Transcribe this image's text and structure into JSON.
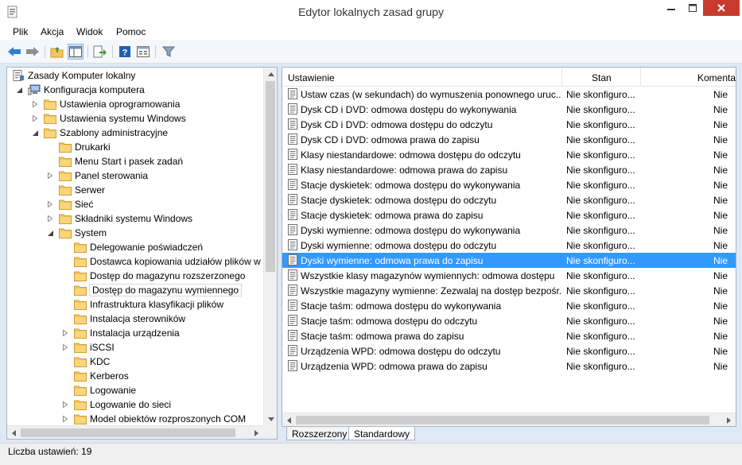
{
  "window": {
    "title": "Edytor lokalnych zasad grupy"
  },
  "menu": [
    "Plik",
    "Akcja",
    "Widok",
    "Pomoc"
  ],
  "toolbar": [
    "back-icon",
    "forward-icon",
    "up-folder-icon",
    "show-hide-tree-icon",
    "export-list-icon",
    "help-icon",
    "properties-icon",
    "filter-icon"
  ],
  "tree": {
    "root": "Zasady Komputer lokalny",
    "items": [
      {
        "label": "Konfiguracja komputera",
        "level": 1,
        "expander": "expanded",
        "icon": "computer-icon"
      },
      {
        "label": "Ustawienia oprogramowania",
        "level": 2,
        "expander": "collapsed",
        "icon": "folder-icon"
      },
      {
        "label": "Ustawienia systemu Windows",
        "level": 2,
        "expander": "collapsed",
        "icon": "folder-icon"
      },
      {
        "label": "Szablony administracyjne",
        "level": 2,
        "expander": "expanded",
        "icon": "folder-icon"
      },
      {
        "label": "Drukarki",
        "level": 3,
        "expander": "none",
        "icon": "folder-icon"
      },
      {
        "label": "Menu Start i pasek zadań",
        "level": 3,
        "expander": "none",
        "icon": "folder-icon"
      },
      {
        "label": "Panel sterowania",
        "level": 3,
        "expander": "collapsed",
        "icon": "folder-icon"
      },
      {
        "label": "Serwer",
        "level": 3,
        "expander": "none",
        "icon": "folder-icon"
      },
      {
        "label": "Sieć",
        "level": 3,
        "expander": "collapsed",
        "icon": "folder-icon"
      },
      {
        "label": "Składniki systemu Windows",
        "level": 3,
        "expander": "collapsed",
        "icon": "folder-icon"
      },
      {
        "label": "System",
        "level": 3,
        "expander": "expanded",
        "icon": "folder-icon"
      },
      {
        "label": "Delegowanie poświadczeń",
        "level": 4,
        "expander": "none",
        "icon": "folder-icon"
      },
      {
        "label": "Dostawca kopiowania udziałów plików w t",
        "level": 4,
        "expander": "none",
        "icon": "folder-icon"
      },
      {
        "label": "Dostęp do magazynu rozszerzonego",
        "level": 4,
        "expander": "none",
        "icon": "folder-icon"
      },
      {
        "label": "Dostęp do magazynu wymiennego",
        "level": 4,
        "expander": "none",
        "icon": "folder-icon",
        "selected": true
      },
      {
        "label": "Infrastruktura klasyfikacji plików",
        "level": 4,
        "expander": "none",
        "icon": "folder-icon"
      },
      {
        "label": "Instalacja sterowników",
        "level": 4,
        "expander": "none",
        "icon": "folder-icon"
      },
      {
        "label": "Instalacja urządzenia",
        "level": 4,
        "expander": "collapsed",
        "icon": "folder-icon"
      },
      {
        "label": "iSCSI",
        "level": 4,
        "expander": "collapsed",
        "icon": "folder-icon"
      },
      {
        "label": "KDC",
        "level": 4,
        "expander": "none",
        "icon": "folder-icon"
      },
      {
        "label": "Kerberos",
        "level": 4,
        "expander": "none",
        "icon": "folder-icon"
      },
      {
        "label": "Logowanie",
        "level": 4,
        "expander": "none",
        "icon": "folder-icon"
      },
      {
        "label": "Logowanie do sieci",
        "level": 4,
        "expander": "collapsed",
        "icon": "folder-icon"
      },
      {
        "label": "Model obiektów rozproszonych COM",
        "level": 4,
        "expander": "collapsed",
        "icon": "folder-icon"
      }
    ]
  },
  "list": {
    "columns": [
      "Ustawienie",
      "Stan",
      "Komenta"
    ],
    "rows": [
      {
        "name": "Ustaw czas (w sekundach) do wymuszenia ponownego uruc...",
        "state": "Nie skonfiguro...",
        "comment": "Nie"
      },
      {
        "name": "Dysk CD i DVD: odmowa dostępu do wykonywania",
        "state": "Nie skonfiguro...",
        "comment": "Nie"
      },
      {
        "name": "Dysk CD i DVD: odmowa dostępu do odczytu",
        "state": "Nie skonfiguro...",
        "comment": "Nie"
      },
      {
        "name": "Dysk CD i DVD: odmowa prawa do zapisu",
        "state": "Nie skonfiguro...",
        "comment": "Nie"
      },
      {
        "name": "Klasy niestandardowe: odmowa dostępu do odczytu",
        "state": "Nie skonfiguro...",
        "comment": "Nie"
      },
      {
        "name": "Klasy niestandardowe: odmowa prawa do zapisu",
        "state": "Nie skonfiguro...",
        "comment": "Nie"
      },
      {
        "name": "Stacje dyskietek: odmowa dostępu do wykonywania",
        "state": "Nie skonfiguro...",
        "comment": "Nie"
      },
      {
        "name": "Stacje dyskietek: odmowa dostępu do odczytu",
        "state": "Nie skonfiguro...",
        "comment": "Nie"
      },
      {
        "name": "Stacje dyskietek: odmowa prawa do zapisu",
        "state": "Nie skonfiguro...",
        "comment": "Nie"
      },
      {
        "name": "Dyski wymienne: odmowa dostępu do wykonywania",
        "state": "Nie skonfiguro...",
        "comment": "Nie"
      },
      {
        "name": "Dyski wymienne: odmowa dostępu do odczytu",
        "state": "Nie skonfiguro...",
        "comment": "Nie"
      },
      {
        "name": "Dyski wymienne: odmowa prawa do zapisu",
        "state": "Nie skonfiguro...",
        "comment": "Nie",
        "selected": true
      },
      {
        "name": "Wszystkie klasy magazynów wymiennych: odmowa dostępu",
        "state": "Nie skonfiguro...",
        "comment": "Nie"
      },
      {
        "name": "Wszystkie magazyny wymienne: Zezwalaj na dostęp bezpośr...",
        "state": "Nie skonfiguro...",
        "comment": "Nie"
      },
      {
        "name": "Stacje taśm: odmowa dostępu do wykonywania",
        "state": "Nie skonfiguro...",
        "comment": "Nie"
      },
      {
        "name": "Stacje taśm: odmowa dostępu do odczytu",
        "state": "Nie skonfiguro...",
        "comment": "Nie"
      },
      {
        "name": "Stacje taśm: odmowa prawa do zapisu",
        "state": "Nie skonfiguro...",
        "comment": "Nie"
      },
      {
        "name": "Urządzenia WPD: odmowa dostępu do odczytu",
        "state": "Nie skonfiguro...",
        "comment": "Nie"
      },
      {
        "name": "Urządzenia WPD: odmowa prawa do zapisu",
        "state": "Nie skonfiguro...",
        "comment": "Nie"
      }
    ]
  },
  "tabs": [
    {
      "label": "Rozszerzony",
      "active": false
    },
    {
      "label": "Standardowy",
      "active": true
    }
  ],
  "status": {
    "text": "Liczba ustawień: 19"
  },
  "colors": {
    "selection": "#3399ff",
    "close_button": "#c73b2f",
    "folder": "#f4c55b"
  }
}
